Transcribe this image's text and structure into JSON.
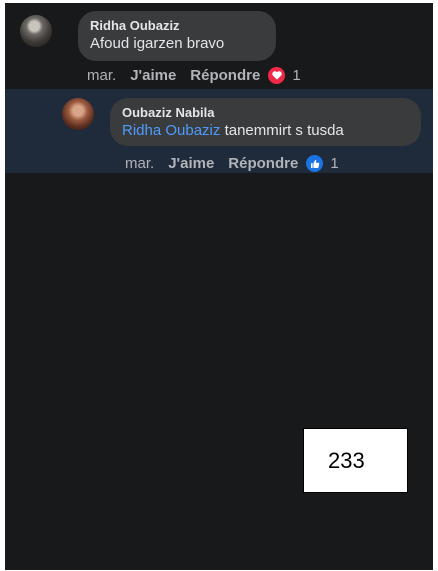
{
  "comments": [
    {
      "author": "Ridha Oubaziz",
      "text": "Afoud igarzen bravo",
      "time": "mar.",
      "like_label": "J'aime",
      "reply_label": "Répondre",
      "reaction": {
        "icon": "heart-icon",
        "count": "1",
        "color": "#f0284a"
      }
    },
    {
      "author": "Oubaziz Nabila",
      "mention": "Ridha Oubaziz",
      "text": "tanemmirt s tusda",
      "time": "mar.",
      "like_label": "J'aime",
      "reply_label": "Répondre",
      "reaction": {
        "icon": "thumbs-up-icon",
        "count": "1",
        "color": "#1b74e4"
      }
    }
  ],
  "page_label": "233",
  "colors": {
    "background": "#18191a",
    "bubble": "#3a3b3c",
    "highlight_row": "#1f2a3a",
    "mention": "#4c9cff",
    "meta_text": "#b0b3b8"
  }
}
